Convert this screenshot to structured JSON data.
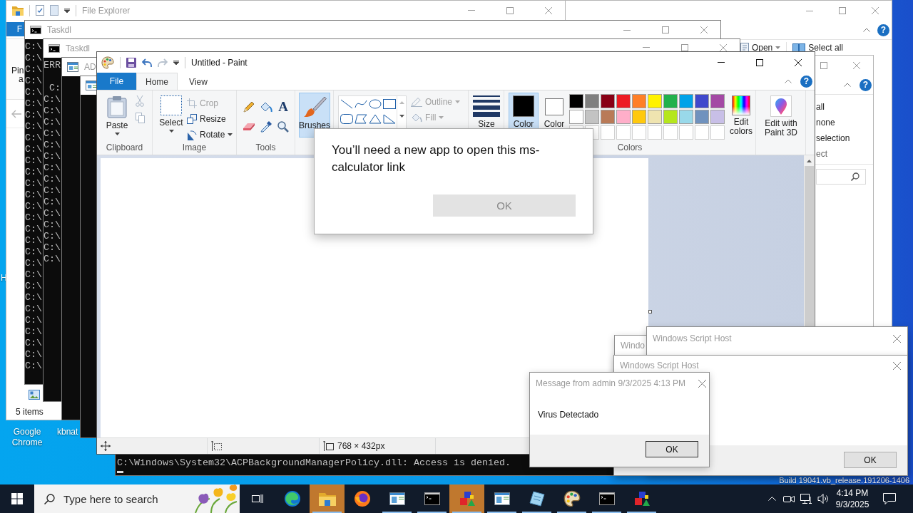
{
  "desktop": {
    "edge_label": "H",
    "icons": [
      {
        "label": "Google Chrome"
      },
      {
        "label": "kbnat"
      }
    ],
    "build_info": "Build 19041.vb_release.191206-1406"
  },
  "explorer_back": {
    "help": "?",
    "ribbon": [
      {
        "kind": "open",
        "label": "Open",
        "dropdown": true
      },
      {
        "kind": "select_all",
        "label": "Select all",
        "dropdown": false
      }
    ]
  },
  "explorer_right": {
    "help": "?",
    "select_commands": [
      "all",
      "none",
      "selection"
    ],
    "group_label": "ect"
  },
  "explorer_front": {
    "title": "File Explorer",
    "file_tab": "F",
    "ribbon_lines": [
      "Pin",
      "a"
    ],
    "status": "5 items"
  },
  "consoles": [
    {
      "kind": "console",
      "title": "Taskdl",
      "blocks": [
        [
          "C:\\",
          "C:\\",
          "C:\\",
          "C:\\",
          "C:\\",
          "C:\\",
          "C:\\",
          "C:\\",
          "C:\\",
          "C:\\",
          "C:\\",
          "C:\\",
          "C:\\",
          "C:\\",
          "C:\\",
          "C:\\",
          "C:\\",
          "C:\\",
          "C:\\",
          "C:\\",
          "C:\\",
          "C:\\",
          "C:\\",
          "C:\\",
          "C:\\",
          "C:\\",
          "C:\\",
          "C:\\",
          "C:\\"
        ]
      ]
    },
    {
      "kind": "console",
      "title": "Taskdl",
      "blocks": [
        [
          "ERR"
        ],
        [
          " C:",
          "C:\\",
          "C:\\",
          "C:\\",
          "C:\\",
          "C:\\",
          "C:\\",
          "C:\\",
          "C:\\",
          "C:\\",
          "C:\\",
          "C:\\",
          "C:\\",
          "C:\\",
          "C:\\",
          "C:\\"
        ]
      ]
    },
    {
      "kind": "app",
      "title": "AD"
    },
    {
      "kind": "app"
    }
  ],
  "console_bottom": {
    "lines": [
      "C:\\Windows\\System32\\ACPBackgroundManagerPolicy.dll: Access is denied."
    ]
  },
  "paint": {
    "title": "Untitled - Paint",
    "file_tab": "File",
    "tabs": [
      {
        "label": "Home",
        "selected": true
      },
      {
        "label": "View",
        "selected": false
      }
    ],
    "help": "?",
    "clipboard": {
      "paste": "Paste",
      "cut": {
        "disabled": true
      },
      "copy": {
        "disabled": true
      },
      "label": "Clipboard"
    },
    "image": {
      "select": "Select",
      "crop": {
        "label": "Crop",
        "disabled": true
      },
      "resize": "Resize",
      "rotate": "Rotate",
      "label": "Image"
    },
    "tools": {
      "text_tool": "A",
      "label": "Tools"
    },
    "brushes": {
      "label": "Brushes",
      "selected": true
    },
    "outline": {
      "label": "Outline",
      "disabled": true
    },
    "fill": {
      "label": "Fill",
      "disabled": true
    },
    "size": "Size",
    "color1": {
      "label": "Color",
      "color": "#000000",
      "selected": true
    },
    "color2": {
      "label": "Color",
      "color": "#ffffff",
      "selected": false
    },
    "palette": [
      {
        "kind": "color",
        "color": "#000000"
      },
      {
        "kind": "color",
        "color": "#7f7f7f"
      },
      {
        "kind": "color",
        "color": "#880015"
      },
      {
        "kind": "color",
        "color": "#ed1c24"
      },
      {
        "kind": "color",
        "color": "#ff7f27"
      },
      {
        "kind": "color",
        "color": "#fff200"
      },
      {
        "kind": "color",
        "color": "#22b14c"
      },
      {
        "kind": "color",
        "color": "#00a2e8"
      },
      {
        "kind": "color",
        "color": "#3f48cc"
      },
      {
        "kind": "color",
        "color": "#a349a4"
      },
      {
        "kind": "color",
        "color": "#ffffff"
      },
      {
        "kind": "color",
        "color": "#c3c3c3"
      },
      {
        "kind": "color",
        "color": "#b97a57"
      },
      {
        "kind": "color",
        "color": "#ffaec9"
      },
      {
        "kind": "color",
        "color": "#ffc90e"
      },
      {
        "kind": "color",
        "color": "#efe4b0"
      },
      {
        "kind": "color",
        "color": "#b5e61d"
      },
      {
        "kind": "color",
        "color": "#99d9ea"
      },
      {
        "kind": "color",
        "color": "#7092be"
      },
      {
        "kind": "color",
        "color": "#c8bfe7"
      },
      {
        "kind": "empty"
      },
      {
        "kind": "empty"
      },
      {
        "kind": "empty"
      },
      {
        "kind": "empty"
      },
      {
        "kind": "empty"
      },
      {
        "kind": "empty"
      },
      {
        "kind": "empty"
      },
      {
        "kind": "empty"
      },
      {
        "kind": "empty"
      },
      {
        "kind": "empty"
      }
    ],
    "edit_colors": "Edit colors",
    "paint_3d": "Edit with Paint 3D",
    "colors_label": "Colors",
    "status": {
      "canvas_size": "768 × 432px"
    }
  },
  "app_prompt": {
    "message": "You’ll need a new app to open this ms-calculator link",
    "button": {
      "label": "OK",
      "disabled": true
    }
  },
  "script_host_windows": [
    {
      "title": "Windo"
    },
    {
      "title": "Windows Script Host"
    },
    {
      "title": "Windows Script Host",
      "button": "OK"
    }
  ],
  "message_box": {
    "title": "Message from admin 9/3/2025 4:13 PM",
    "body": "Virus Detectado",
    "button": "OK"
  },
  "taskbar": {
    "search": {
      "placeholder": "Type here to search"
    },
    "apps": [
      {
        "kind": "edge",
        "running": false,
        "flashing": false
      },
      {
        "kind": "explorer",
        "running": true,
        "flashing": true
      },
      {
        "kind": "firefox",
        "running": false,
        "flashing": false
      },
      {
        "kind": "window",
        "running": true,
        "flashing": false
      },
      {
        "kind": "console",
        "running": true,
        "flashing": false
      },
      {
        "kind": "blocks",
        "running": true,
        "flashing": true
      },
      {
        "kind": "window",
        "running": true,
        "flashing": false
      },
      {
        "kind": "notepad",
        "running": true,
        "flashing": false
      },
      {
        "kind": "paint",
        "running": true,
        "flashing": false
      },
      {
        "kind": "console",
        "running": true,
        "flashing": false
      },
      {
        "kind": "blocks",
        "running": true,
        "flashing": false
      }
    ],
    "clock": {
      "time": "4:14 PM",
      "date": "9/3/2025"
    }
  }
}
